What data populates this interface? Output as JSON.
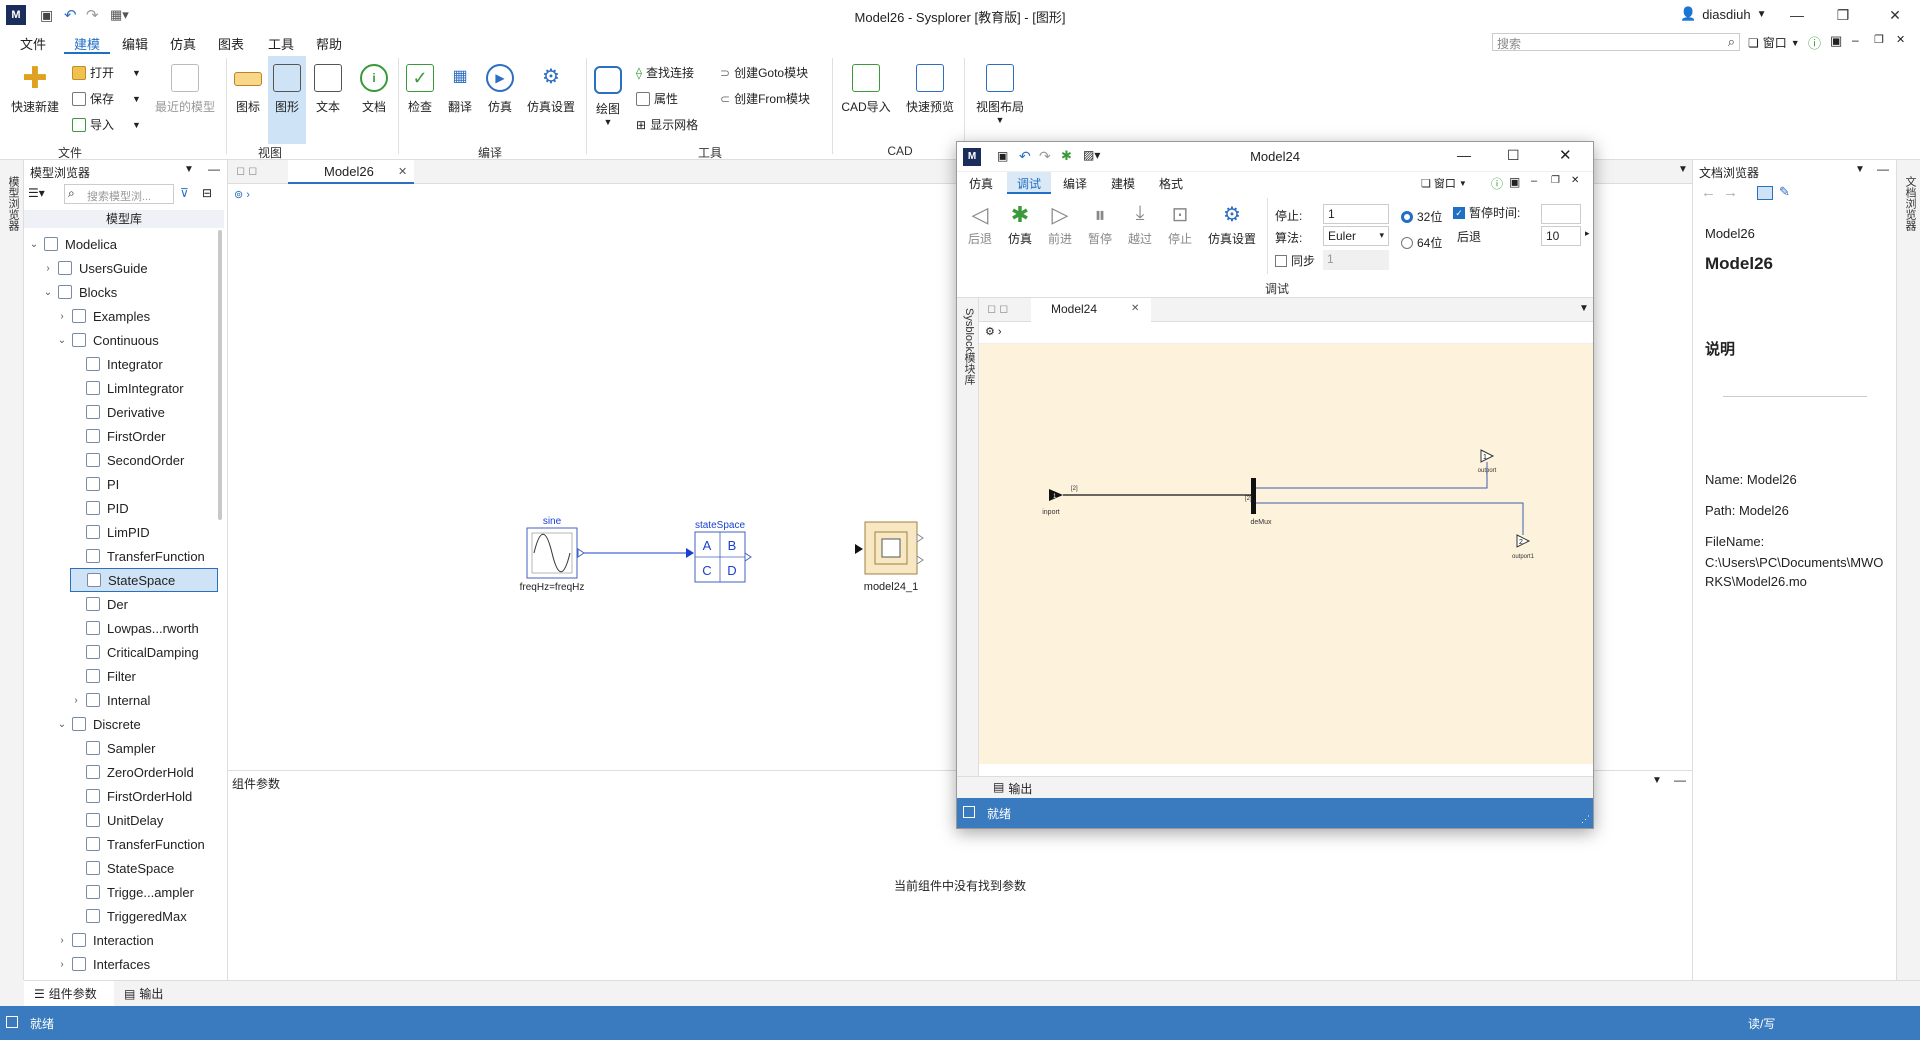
{
  "app": {
    "title": "Model26 - Sysplorer [教育版] - [图形]",
    "user": "diasdiuh",
    "search_placeholder": "搜索",
    "window_menu": "窗口"
  },
  "menu": [
    "文件",
    "建模",
    "编辑",
    "仿真",
    "图表",
    "工具",
    "帮助"
  ],
  "ribbon": {
    "new": "快速新建",
    "open": "打开",
    "save": "保存",
    "import": "导入",
    "recent": "最近的模型",
    "icon": "图标",
    "graphic": "图形",
    "text": "文本",
    "doc": "文档",
    "check": "检查",
    "translate": "翻译",
    "simulate": "仿真",
    "sim_settings": "仿真设置",
    "draw": "绘图",
    "find_conn": "查找连接",
    "attr": "属性",
    "show_grid": "显示网格",
    "create_goto": "创建Goto模块",
    "create_from": "创建From模块",
    "cad_import": "CAD导入",
    "quick_preview": "快速预览",
    "view_layout": "视图布局",
    "group_file": "文件",
    "group_view": "视图",
    "group_compile": "编译",
    "group_tools": "工具",
    "group_cad": "CAD"
  },
  "browser": {
    "title": "模型浏览器",
    "search_placeholder": "搜索模型浏...",
    "header": "模型库",
    "side_tab": "模型浏览器",
    "items": [
      {
        "label": "Modelica",
        "lvl": 0,
        "arrow": "v"
      },
      {
        "label": "UsersGuide",
        "lvl": 1,
        "arrow": ">"
      },
      {
        "label": "Blocks",
        "lvl": 1,
        "arrow": "v"
      },
      {
        "label": "Examples",
        "lvl": 2,
        "arrow": ">"
      },
      {
        "label": "Continuous",
        "lvl": 2,
        "arrow": "v"
      },
      {
        "label": "Integrator",
        "lvl": 3,
        "arrow": ""
      },
      {
        "label": "LimIntegrator",
        "lvl": 3,
        "arrow": ""
      },
      {
        "label": "Derivative",
        "lvl": 3,
        "arrow": ""
      },
      {
        "label": "FirstOrder",
        "lvl": 3,
        "arrow": ""
      },
      {
        "label": "SecondOrder",
        "lvl": 3,
        "arrow": ""
      },
      {
        "label": "PI",
        "lvl": 3,
        "arrow": ""
      },
      {
        "label": "PID",
        "lvl": 3,
        "arrow": ""
      },
      {
        "label": "LimPID",
        "lvl": 3,
        "arrow": ""
      },
      {
        "label": "TransferFunction",
        "lvl": 3,
        "arrow": ""
      },
      {
        "label": "StateSpace",
        "lvl": 3,
        "arrow": "",
        "selected": true
      },
      {
        "label": "Der",
        "lvl": 3,
        "arrow": ""
      },
      {
        "label": "Lowpas...rworth",
        "lvl": 3,
        "arrow": ""
      },
      {
        "label": "CriticalDamping",
        "lvl": 3,
        "arrow": ""
      },
      {
        "label": "Filter",
        "lvl": 3,
        "arrow": ""
      },
      {
        "label": "Internal",
        "lvl": 3,
        "arrow": ">"
      },
      {
        "label": "Discrete",
        "lvl": 2,
        "arrow": "v"
      },
      {
        "label": "Sampler",
        "lvl": 3,
        "arrow": ""
      },
      {
        "label": "ZeroOrderHold",
        "lvl": 3,
        "arrow": ""
      },
      {
        "label": "FirstOrderHold",
        "lvl": 3,
        "arrow": ""
      },
      {
        "label": "UnitDelay",
        "lvl": 3,
        "arrow": ""
      },
      {
        "label": "TransferFunction",
        "lvl": 3,
        "arrow": ""
      },
      {
        "label": "StateSpace",
        "lvl": 3,
        "arrow": ""
      },
      {
        "label": "Trigge...ampler",
        "lvl": 3,
        "arrow": ""
      },
      {
        "label": "TriggeredMax",
        "lvl": 3,
        "arrow": ""
      },
      {
        "label": "Interaction",
        "lvl": 2,
        "arrow": ">"
      },
      {
        "label": "Interfaces",
        "lvl": 2,
        "arrow": ">"
      }
    ]
  },
  "doc": {
    "tab": "Model26",
    "blocks": {
      "sine": "sine",
      "sine_param": "freqHz=freqHz",
      "statespace": "stateSpace",
      "A": "A",
      "B": "B",
      "C": "C",
      "D": "D",
      "model": "model24_1"
    }
  },
  "params": {
    "title": "组件参数",
    "empty": "当前组件中没有找到参数"
  },
  "right": {
    "title": "文档浏览器",
    "side_tab": "文档浏览器",
    "model_small": "Model26",
    "model_big": "Model26",
    "desc": "说明",
    "name": "Name: Model26",
    "path": "Path: Model26",
    "filename_label": "FileName:",
    "filename": "C:\\Users\\PC\\Documents\\MWORKS\\Model26.mo"
  },
  "bottom_tabs": [
    "组件参数",
    "输出"
  ],
  "status": {
    "left": "就绪",
    "right": "读/写"
  },
  "float": {
    "title": "Model24",
    "tabs": [
      "仿真",
      "调试",
      "编译",
      "建模",
      "格式"
    ],
    "tools": [
      "后退",
      "仿真",
      "前进",
      "暂停",
      "越过",
      "停止",
      "仿真设置"
    ],
    "stop_label": "停止:",
    "stop_val": "1",
    "algo_label": "算法:",
    "algo_val": "Euler",
    "sync_label": "同步",
    "sync_val": "1",
    "bits32": "32位",
    "bits64": "64位",
    "pause_label": "暂停时间:",
    "back_label": "后退",
    "back_val": "10",
    "group": "调试",
    "side_tab": "Sysblock模块库",
    "doc_tab": "Model24",
    "inport": "inport",
    "demux": "deMux",
    "out1": "outport",
    "out2": "outport1",
    "num1": "1",
    "num2": "2",
    "dim": "[2]",
    "output": "输出",
    "status": "就绪",
    "window_menu": "窗口"
  }
}
